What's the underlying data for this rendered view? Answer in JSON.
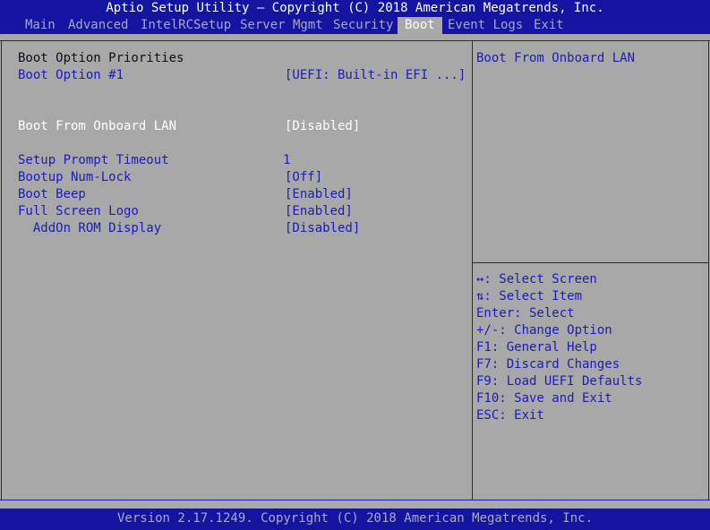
{
  "title": "Aptio Setup Utility – Copyright (C) 2018 American Megatrends, Inc.",
  "menu": {
    "main": "Main",
    "advanced": "Advanced",
    "intelrc": "IntelRCSetup",
    "server_mgmt": "Server Mgmt",
    "security": "Security",
    "boot": "Boot",
    "event_logs": "Event Logs",
    "exit": "Exit"
  },
  "settings": {
    "section_header": "Boot Option Priorities",
    "boot_option_1": {
      "label": "Boot Option #1",
      "value": "[UEFI: Built-in EFI ...]"
    },
    "boot_from_lan": {
      "label": "Boot From Onboard LAN",
      "value": "[Disabled]"
    },
    "setup_prompt": {
      "label": "Setup Prompt Timeout",
      "value": "1"
    },
    "numlock": {
      "label": "Bootup Num-Lock",
      "value": "[Off]"
    },
    "boot_beep": {
      "label": "Boot Beep",
      "value": "[Enabled]"
    },
    "full_screen_logo": {
      "label": "Full Screen Logo",
      "value": "[Enabled]"
    },
    "addon_rom": {
      "label": "  AddOn ROM Display",
      "value": "[Disabled]"
    }
  },
  "help": {
    "description": "Boot From Onboard LAN",
    "keys": [
      "↔: Select Screen",
      "⇅: Select Item",
      "Enter: Select",
      "+/-: Change Option",
      "F1: General Help",
      "F7: Discard Changes",
      "F9: Load UEFI Defaults",
      "F10: Save and Exit",
      "ESC: Exit"
    ]
  },
  "footer": "Version 2.17.1249. Copyright (C) 2018 American Megatrends, Inc.",
  "colors": {
    "bar_blue": "#1414a0",
    "panel_gray": "#a8a8a8",
    "option_blue": "#1c1cb8",
    "selected_white": "#ffffff"
  }
}
